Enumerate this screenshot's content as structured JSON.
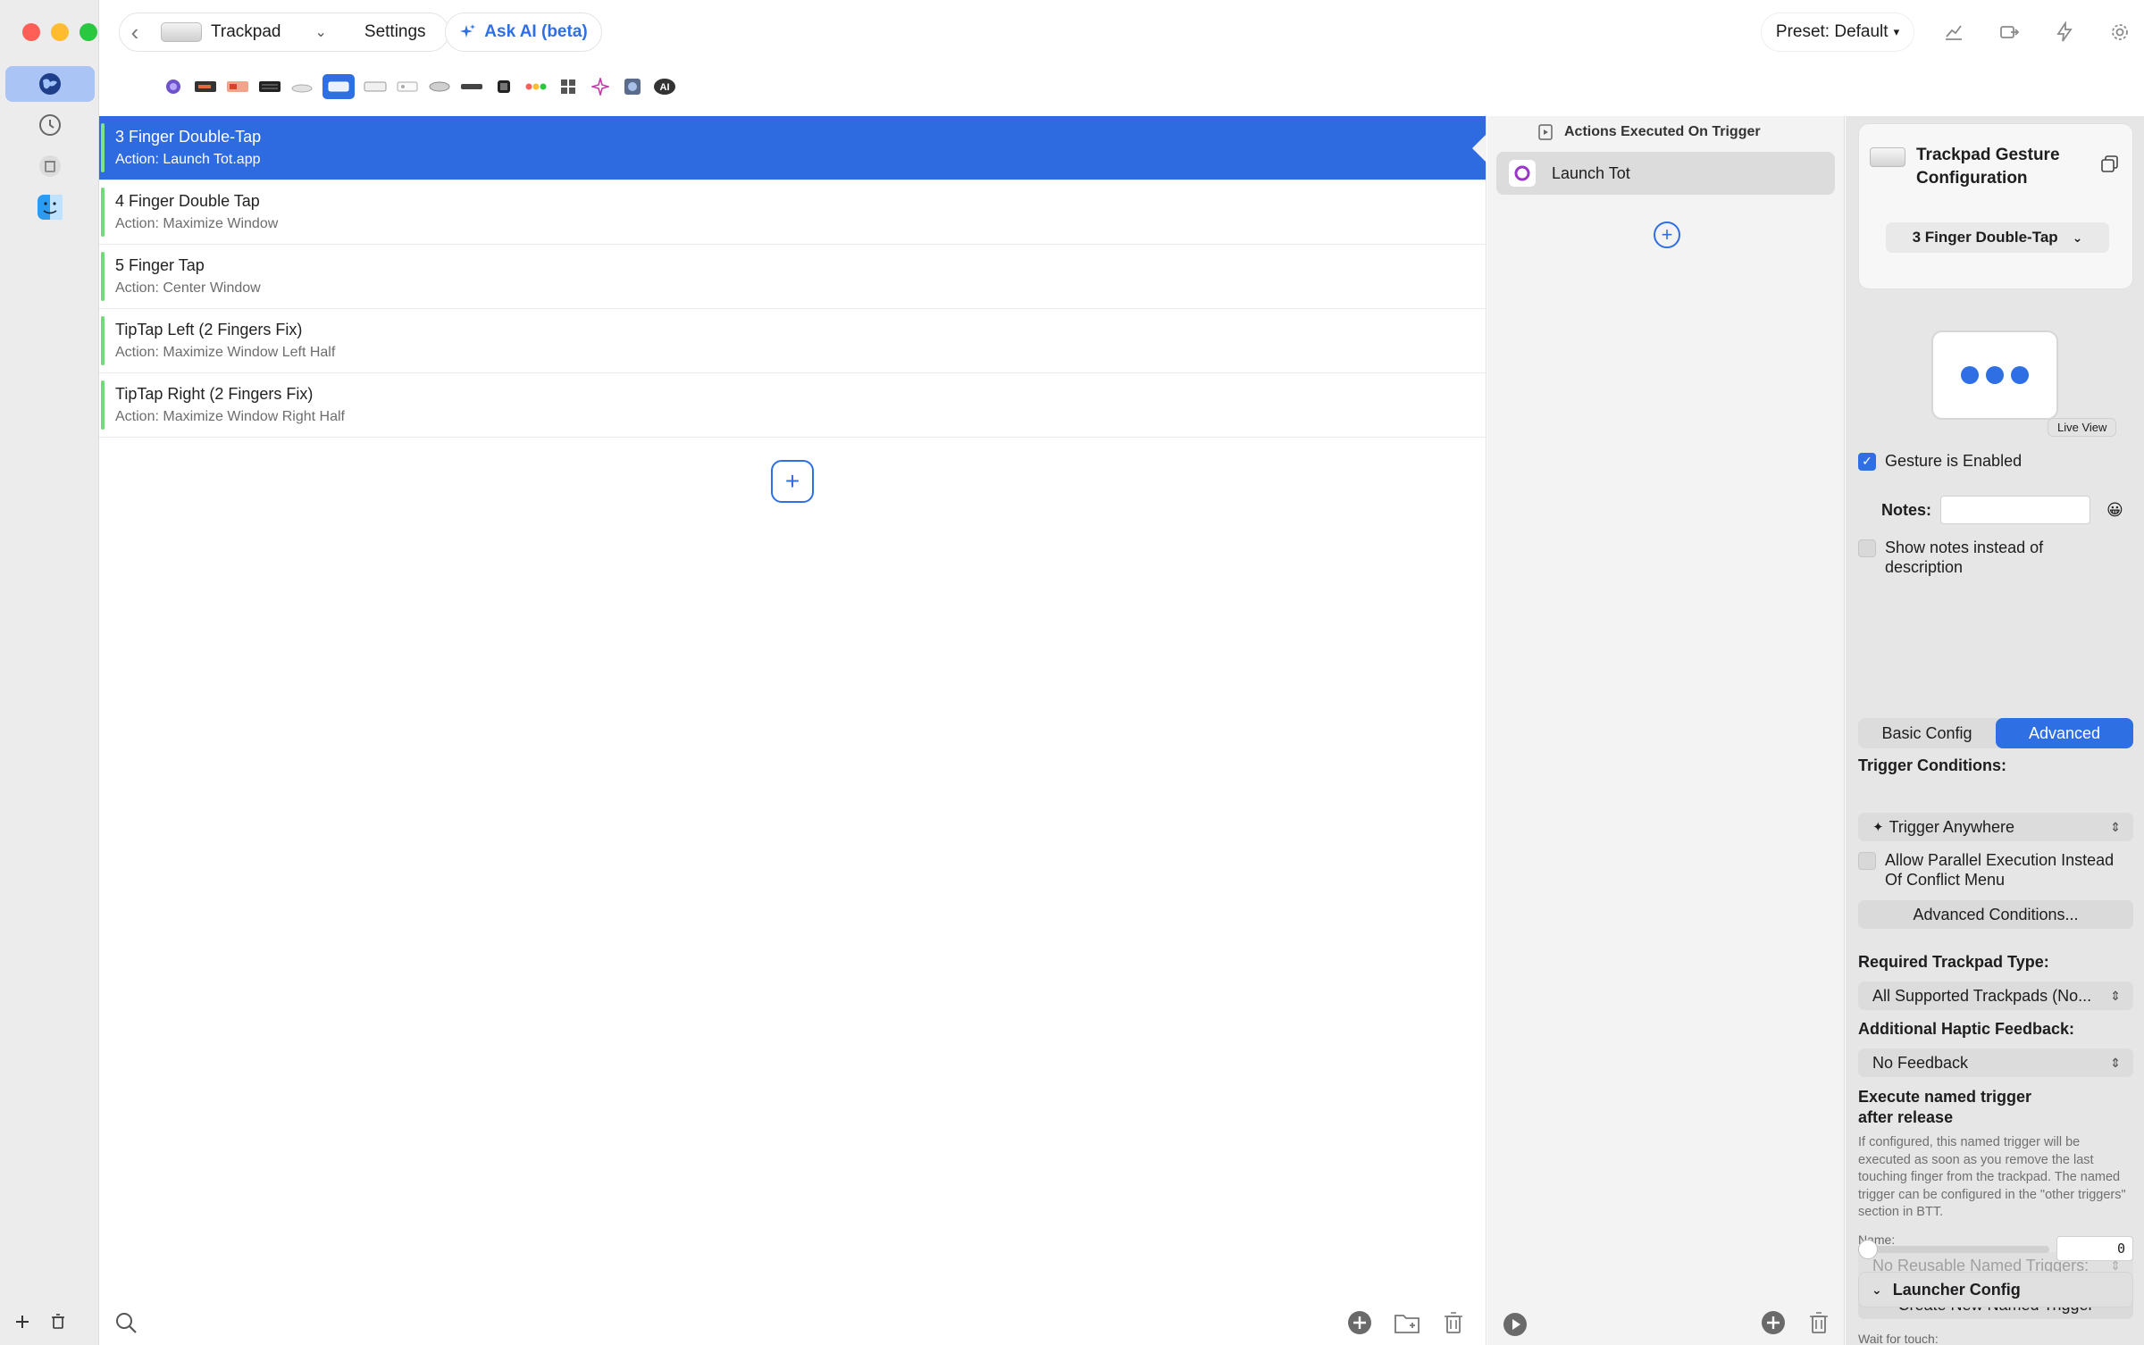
{
  "toolbar": {
    "device_label": "Trackpad",
    "settings_label": "Settings",
    "ai_label": "Ask AI (beta)",
    "preset_label": "Preset: Default",
    "preset_caret": "▾"
  },
  "triggers": [
    {
      "title": "3 Finger Double-Tap",
      "action": "Action: Launch Tot.app",
      "selected": true
    },
    {
      "title": "4 Finger Double Tap",
      "action": "Action: Maximize Window",
      "selected": false
    },
    {
      "title": "5 Finger Tap",
      "action": "Action: Center Window",
      "selected": false
    },
    {
      "title": "TipTap Left (2 Fingers Fix)",
      "action": "Action: Maximize Window Left Half",
      "selected": false
    },
    {
      "title": "TipTap Right (2 Fingers Fix)",
      "action": "Action: Maximize Window Right Half",
      "selected": false
    }
  ],
  "actions": {
    "header": "Actions Executed On Trigger",
    "items": [
      {
        "label": "Launch Tot"
      }
    ]
  },
  "config": {
    "title": "Trackpad Gesture Configuration",
    "gesture_select": "3 Finger Double-Tap",
    "live_view": "Live View",
    "gesture_enabled": "Gesture is Enabled",
    "notes_label": "Notes:",
    "notes_emoji": "😀",
    "show_notes": "Show notes instead of description",
    "tab_basic": "Basic Config",
    "tab_advanced": "Advanced",
    "trigger_conditions": "Trigger Conditions:",
    "trigger_anywhere": "Trigger Anywhere",
    "allow_parallel": "Allow Parallel Execution Instead Of Conflict Menu",
    "advanced_conditions": "Advanced Conditions...",
    "required_type_label": "Required Trackpad Type:",
    "required_type_value": "All Supported Trackpads (No...",
    "haptic_label": "Additional Haptic Feedback:",
    "haptic_value": "No Feedback",
    "named_trigger_label": "Execute named trigger after release",
    "named_trigger_help": "If configured, this named trigger will be executed as soon as you remove the last touching finger from the trackpad. The named trigger can be configured in the \"other triggers\" section in BTT.",
    "name_label": "Name:",
    "name_value": "No Reusable Named Triggers:",
    "create_named": "Create New Named Trigger",
    "wait_label": "Wait for touch:",
    "wait_value": "0",
    "launcher_config": "Launcher Config"
  }
}
